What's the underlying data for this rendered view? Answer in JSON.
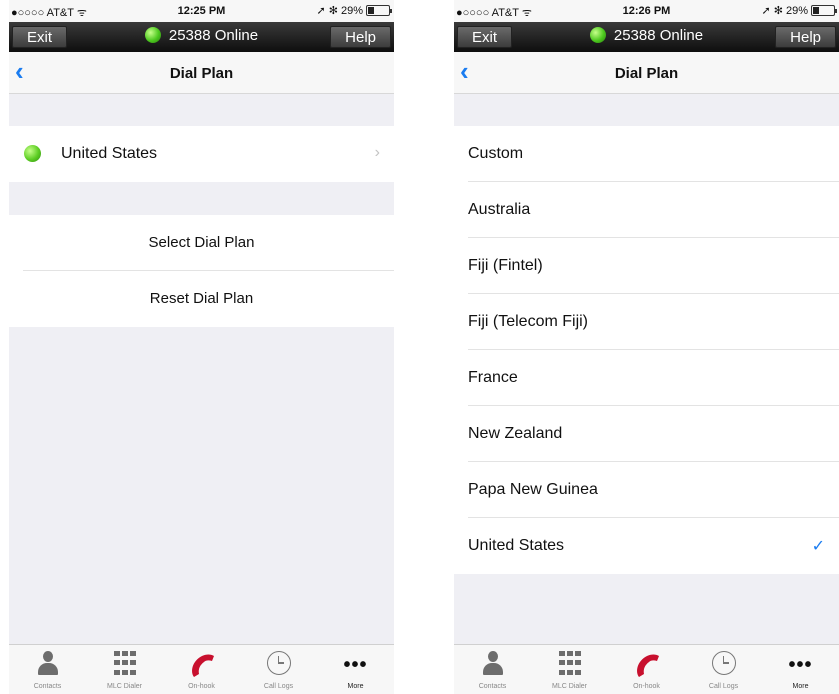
{
  "status_bar": {
    "left": {
      "carrier": "●○○○○ AT&T ᯤ",
      "time": "12:25 PM",
      "battery_text": "➚ ✻ 29%",
      "battery_level": 0.29
    },
    "right": {
      "carrier": "●○○○○ AT&T ᯤ",
      "time": "12:26 PM",
      "battery_text": "➚ ✻ 29%",
      "battery_level": 0.29
    }
  },
  "app_bar": {
    "exit_label": "Exit",
    "status_text": "25388 Online",
    "help_label": "Help"
  },
  "nav": {
    "back_glyph": "‹",
    "title": "Dial Plan"
  },
  "left_screen": {
    "current_plan": "United States",
    "chevron_glyph": "›",
    "actions": [
      "Select Dial Plan",
      "Reset Dial Plan"
    ]
  },
  "right_screen": {
    "options": [
      "Custom",
      "Australia",
      "Fiji (Fintel)",
      "Fiji (Telecom Fiji)",
      "France",
      "New Zealand",
      "Papa New Guinea",
      "United States"
    ],
    "selected": "United States",
    "check_glyph": "✓"
  },
  "tab_bar": {
    "tabs": [
      {
        "label": "Contacts",
        "icon": "person-icon"
      },
      {
        "label": "MLC Dialer",
        "icon": "keypad-icon"
      },
      {
        "label": "On-hook",
        "icon": "phone-handset-icon"
      },
      {
        "label": "Call Logs",
        "icon": "clock-icon"
      },
      {
        "label": "More",
        "icon": "more-dots-icon"
      }
    ],
    "active_index": 4,
    "more_glyph": "•••"
  },
  "colors": {
    "accent_blue": "#1a7cf0",
    "online_green": "#4cc81e",
    "handset_red": "#c8102e"
  }
}
